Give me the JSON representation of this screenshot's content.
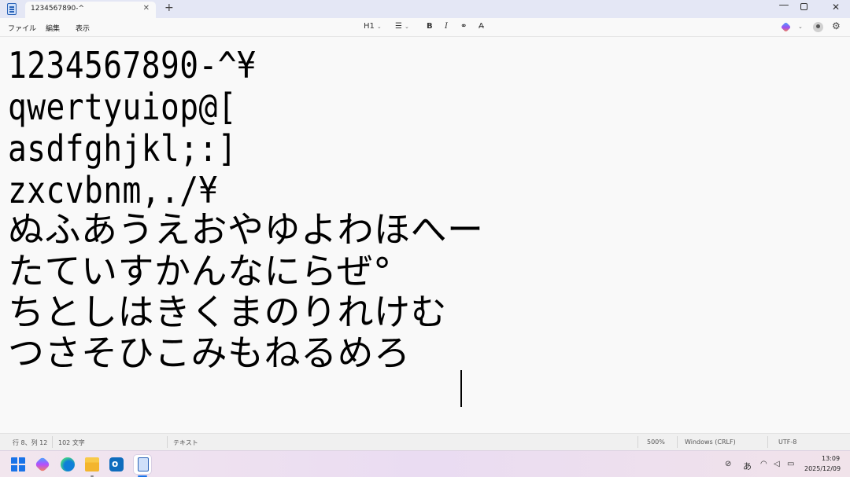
{
  "window": {
    "tab_title": "1234567890-^",
    "tab_close": "✕",
    "tab_add": "+",
    "minimize": "—",
    "close": "✕"
  },
  "menu": {
    "items": [
      "ファイル",
      "編集",
      "表示"
    ]
  },
  "toolbar": {
    "heading": "H1",
    "list_icon": "list-icon",
    "bold": "B",
    "italic": "I",
    "link_icon": "link-icon",
    "clear_format": "A̶"
  },
  "editor": {
    "lines": [
      "1234567890-^¥",
      "qwertyuiop@[",
      "asdfghjkl;:]",
      "zxcvbnm,./¥",
      "ぬふあうえおやゆよわほへー",
      "たていすかんなにらぜ°",
      "ちとしはきくまのりれけむ",
      "つさそひこみもねるめろ"
    ]
  },
  "status": {
    "position": "行 8、列 12",
    "char_count": "102 文字",
    "format": "テキスト",
    "zoom": "500%",
    "line_ending": "Windows (CRLF)",
    "encoding": "UTF-8"
  },
  "taskbar": {
    "ime": "あ",
    "time": "13:09",
    "date": "2025/12/09"
  },
  "colors": {
    "accent": "#1a73e8",
    "titlebar": "#e4e7f5",
    "editor_bg": "#f9f9f9"
  }
}
